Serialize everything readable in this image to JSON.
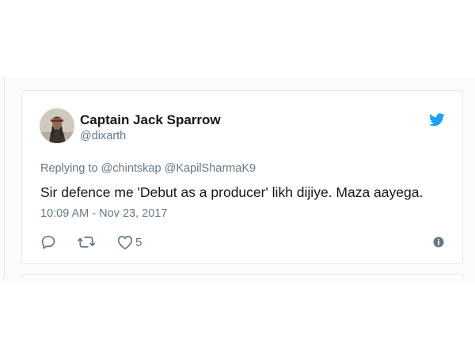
{
  "tweet": {
    "author": {
      "display_name": "Captain Jack Sparrow",
      "handle": "@dixarth"
    },
    "reply_context": {
      "prefix": "Replying to",
      "mentions": [
        "@chintskap",
        "@KapilSharmaK9"
      ]
    },
    "text": "Sir defence me 'Debut as a producer' likh dijiye. Maza aayega.",
    "timestamp": "10:09 AM - Nov 23, 2017",
    "actions": {
      "like_count": "5"
    }
  },
  "colors": {
    "twitter_blue": "#1da1f2",
    "text_primary": "#14171a",
    "text_secondary": "#657786",
    "border": "#e1e8ed"
  },
  "icons": [
    "twitter-bird-icon",
    "reply-icon",
    "retweet-icon",
    "heart-icon",
    "info-icon"
  ]
}
